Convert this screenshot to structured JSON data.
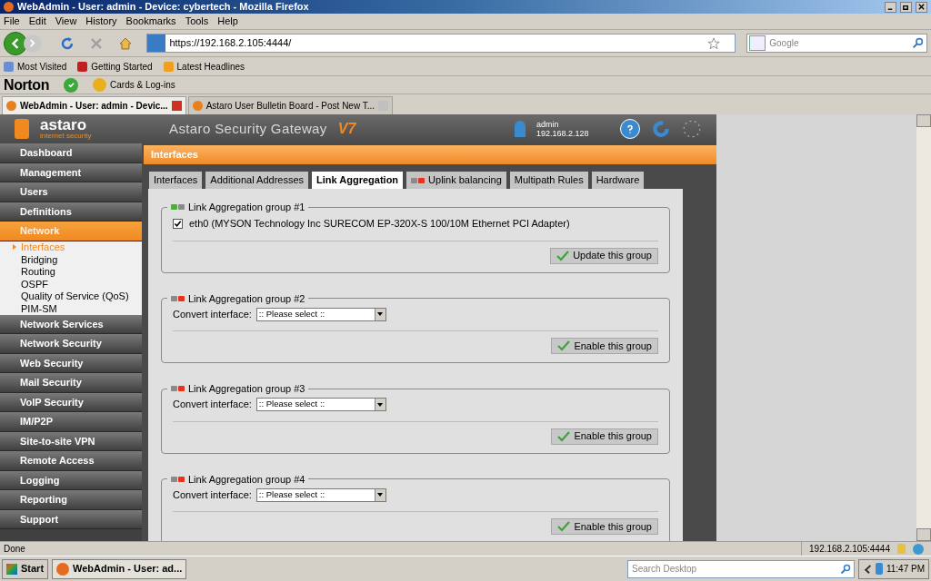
{
  "window": {
    "title": "WebAdmin - User: admin - Device: cybertech - Mozilla Firefox"
  },
  "menu": [
    "File",
    "Edit",
    "View",
    "History",
    "Bookmarks",
    "Tools",
    "Help"
  ],
  "address": {
    "value": "https://192.168.2.105:4444/"
  },
  "search": {
    "placeholder": "Google"
  },
  "bookmarks": [
    "Most Visited",
    "Getting Started",
    "Latest Headlines"
  ],
  "norton": {
    "brand": "Norton",
    "cards": "Cards & Log-ins"
  },
  "browser_tabs": [
    {
      "label": "WebAdmin - User: admin - Devic...",
      "selected": true
    },
    {
      "label": "Astaro User Bulletin Board - Post New T...",
      "selected": false
    }
  ],
  "app": {
    "logo": "astaro",
    "tagline": "internet security",
    "product": "Astaro Security Gateway",
    "version": "V7",
    "user": "admin",
    "ip": "192.168.2.128"
  },
  "sidebar": {
    "items": [
      {
        "label": "Dashboard",
        "selected": false
      },
      {
        "label": "Management",
        "selected": false
      },
      {
        "label": "Users",
        "selected": false
      },
      {
        "label": "Definitions",
        "selected": false
      },
      {
        "label": "Network",
        "selected": true,
        "children": [
          {
            "label": "Interfaces",
            "selected": true
          },
          {
            "label": "Bridging",
            "selected": false
          },
          {
            "label": "Routing",
            "selected": false
          },
          {
            "label": "OSPF",
            "selected": false
          },
          {
            "label": "Quality of Service (QoS)",
            "selected": false
          },
          {
            "label": "PIM-SM",
            "selected": false
          }
        ]
      },
      {
        "label": "Network Services",
        "selected": false
      },
      {
        "label": "Network Security",
        "selected": false
      },
      {
        "label": "Web Security",
        "selected": false
      },
      {
        "label": "Mail Security",
        "selected": false
      },
      {
        "label": "VoIP Security",
        "selected": false
      },
      {
        "label": "IM/P2P",
        "selected": false
      },
      {
        "label": "Site-to-site VPN",
        "selected": false
      },
      {
        "label": "Remote Access",
        "selected": false
      },
      {
        "label": "Logging",
        "selected": false
      },
      {
        "label": "Reporting",
        "selected": false
      },
      {
        "label": "Support",
        "selected": false
      }
    ]
  },
  "page_title": "Interfaces",
  "tabs": [
    {
      "label": "Interfaces",
      "selected": false
    },
    {
      "label": "Additional Addresses",
      "selected": false
    },
    {
      "label": "Link Aggregation",
      "selected": true
    },
    {
      "label": "Uplink balancing",
      "selected": false,
      "indicator": true
    },
    {
      "label": "Multipath Rules",
      "selected": false
    },
    {
      "label": "Hardware",
      "selected": false
    }
  ],
  "groups": [
    {
      "title": "Link Aggregation group #1",
      "active": true,
      "kind": "checkbox",
      "interface": {
        "label": "eth0 (MYSON Technology Inc SURECOM EP-320X-S 100/10M Ethernet PCI Adapter)",
        "checked": true
      },
      "button": "Update this group"
    },
    {
      "title": "Link Aggregation group #2",
      "active": false,
      "kind": "select",
      "field_label": "Convert interface:",
      "select": ":: Please select ::",
      "button": "Enable this group"
    },
    {
      "title": "Link Aggregation group #3",
      "active": false,
      "kind": "select",
      "field_label": "Convert interface:",
      "select": ":: Please select ::",
      "button": "Enable this group"
    },
    {
      "title": "Link Aggregation group #4",
      "active": false,
      "kind": "select",
      "field_label": "Convert interface:",
      "select": ":: Please select ::",
      "button": "Enable this group"
    }
  ],
  "status_bar": {
    "text": "Done",
    "host": "192.168.2.105:4444"
  },
  "taskbar": {
    "start": "Start",
    "task": "WebAdmin - User: ad...",
    "search_placeholder": "Search Desktop",
    "time": "11:47 PM"
  }
}
